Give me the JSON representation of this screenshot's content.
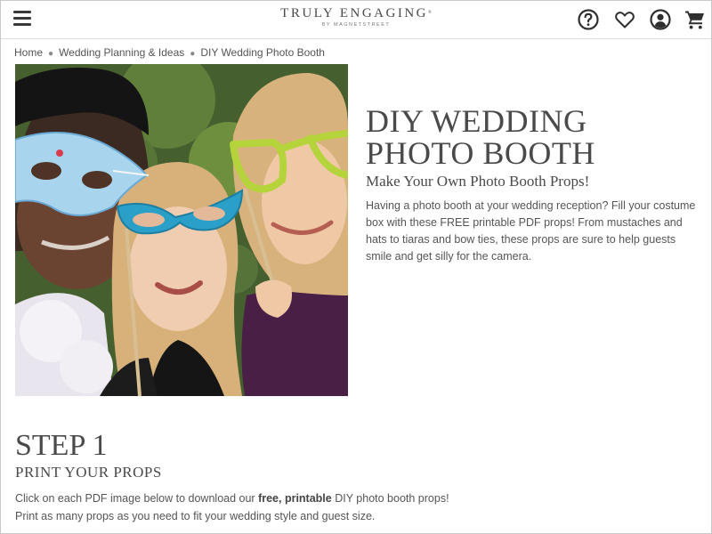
{
  "header": {
    "logo_main": "TRULY ENGAGING",
    "logo_sub": "BY MAGNETSTREET",
    "icons": [
      "menu-icon",
      "help-icon",
      "heart-icon",
      "account-icon",
      "cart-icon"
    ]
  },
  "breadcrumb": {
    "items": [
      "Home",
      "Wedding Planning & Ideas",
      "DIY Wedding Photo Booth"
    ]
  },
  "hero": {
    "title_line1": "DIY WEDDING",
    "title_line2": "PHOTO BOOTH",
    "subtitle": "Make Your Own Photo Booth Props!",
    "body": "Having a photo booth at your wedding reception? Fill your costume box with these FREE printable PDF props! From mustaches and hats to tiaras and bow ties, these props are sure to help guests smile and get silly for the camera."
  },
  "step": {
    "title": "STEP 1",
    "subtitle": "PRINT YOUR PROPS",
    "line1_before": "Click on each PDF image below to download our ",
    "line1_bold": "free, printable",
    "line1_after": " DIY photo booth props!",
    "line2": "Print as many props as you need to fit your wedding style and guest size."
  },
  "colors": {
    "text": "#5a5a5a",
    "heading": "#4a4a4a",
    "mask_blue": "#a8d4ee",
    "glasses_teal": "#2aa0c8",
    "glasses_green": "#b5d43c"
  }
}
